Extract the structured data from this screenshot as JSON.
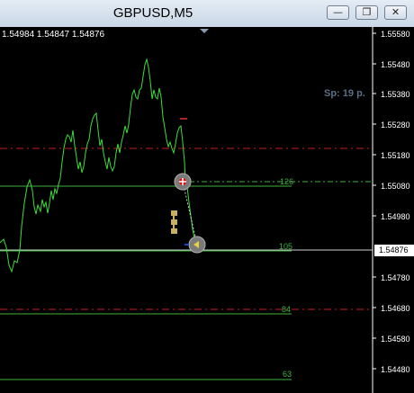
{
  "window": {
    "title": "GBPUSD,M5",
    "buttons": [
      {
        "name": "minimize",
        "glyph": "—"
      },
      {
        "name": "restore",
        "glyph": "❐"
      },
      {
        "name": "close",
        "glyph": "✕"
      }
    ]
  },
  "chart": {
    "ohlc": "1.54984 1.54847 1.54876",
    "spread": "Sp: 19 p.",
    "price_labels": [
      "1.55580",
      "1.55480",
      "1.55380",
      "1.55280",
      "1.55180",
      "1.55080",
      "1.54980",
      "1.54876",
      "1.54780",
      "1.54680",
      "1.54580",
      "1.54480"
    ],
    "level_labels": [
      "126",
      "105",
      "84",
      "63"
    ],
    "current_price": "1.54876",
    "colors": {
      "background": "#000000",
      "price_line": "#3cdc3c",
      "level_line": "#3cb43c",
      "stop_line": "#c81e1e",
      "axis": "#ffffff"
    }
  }
}
